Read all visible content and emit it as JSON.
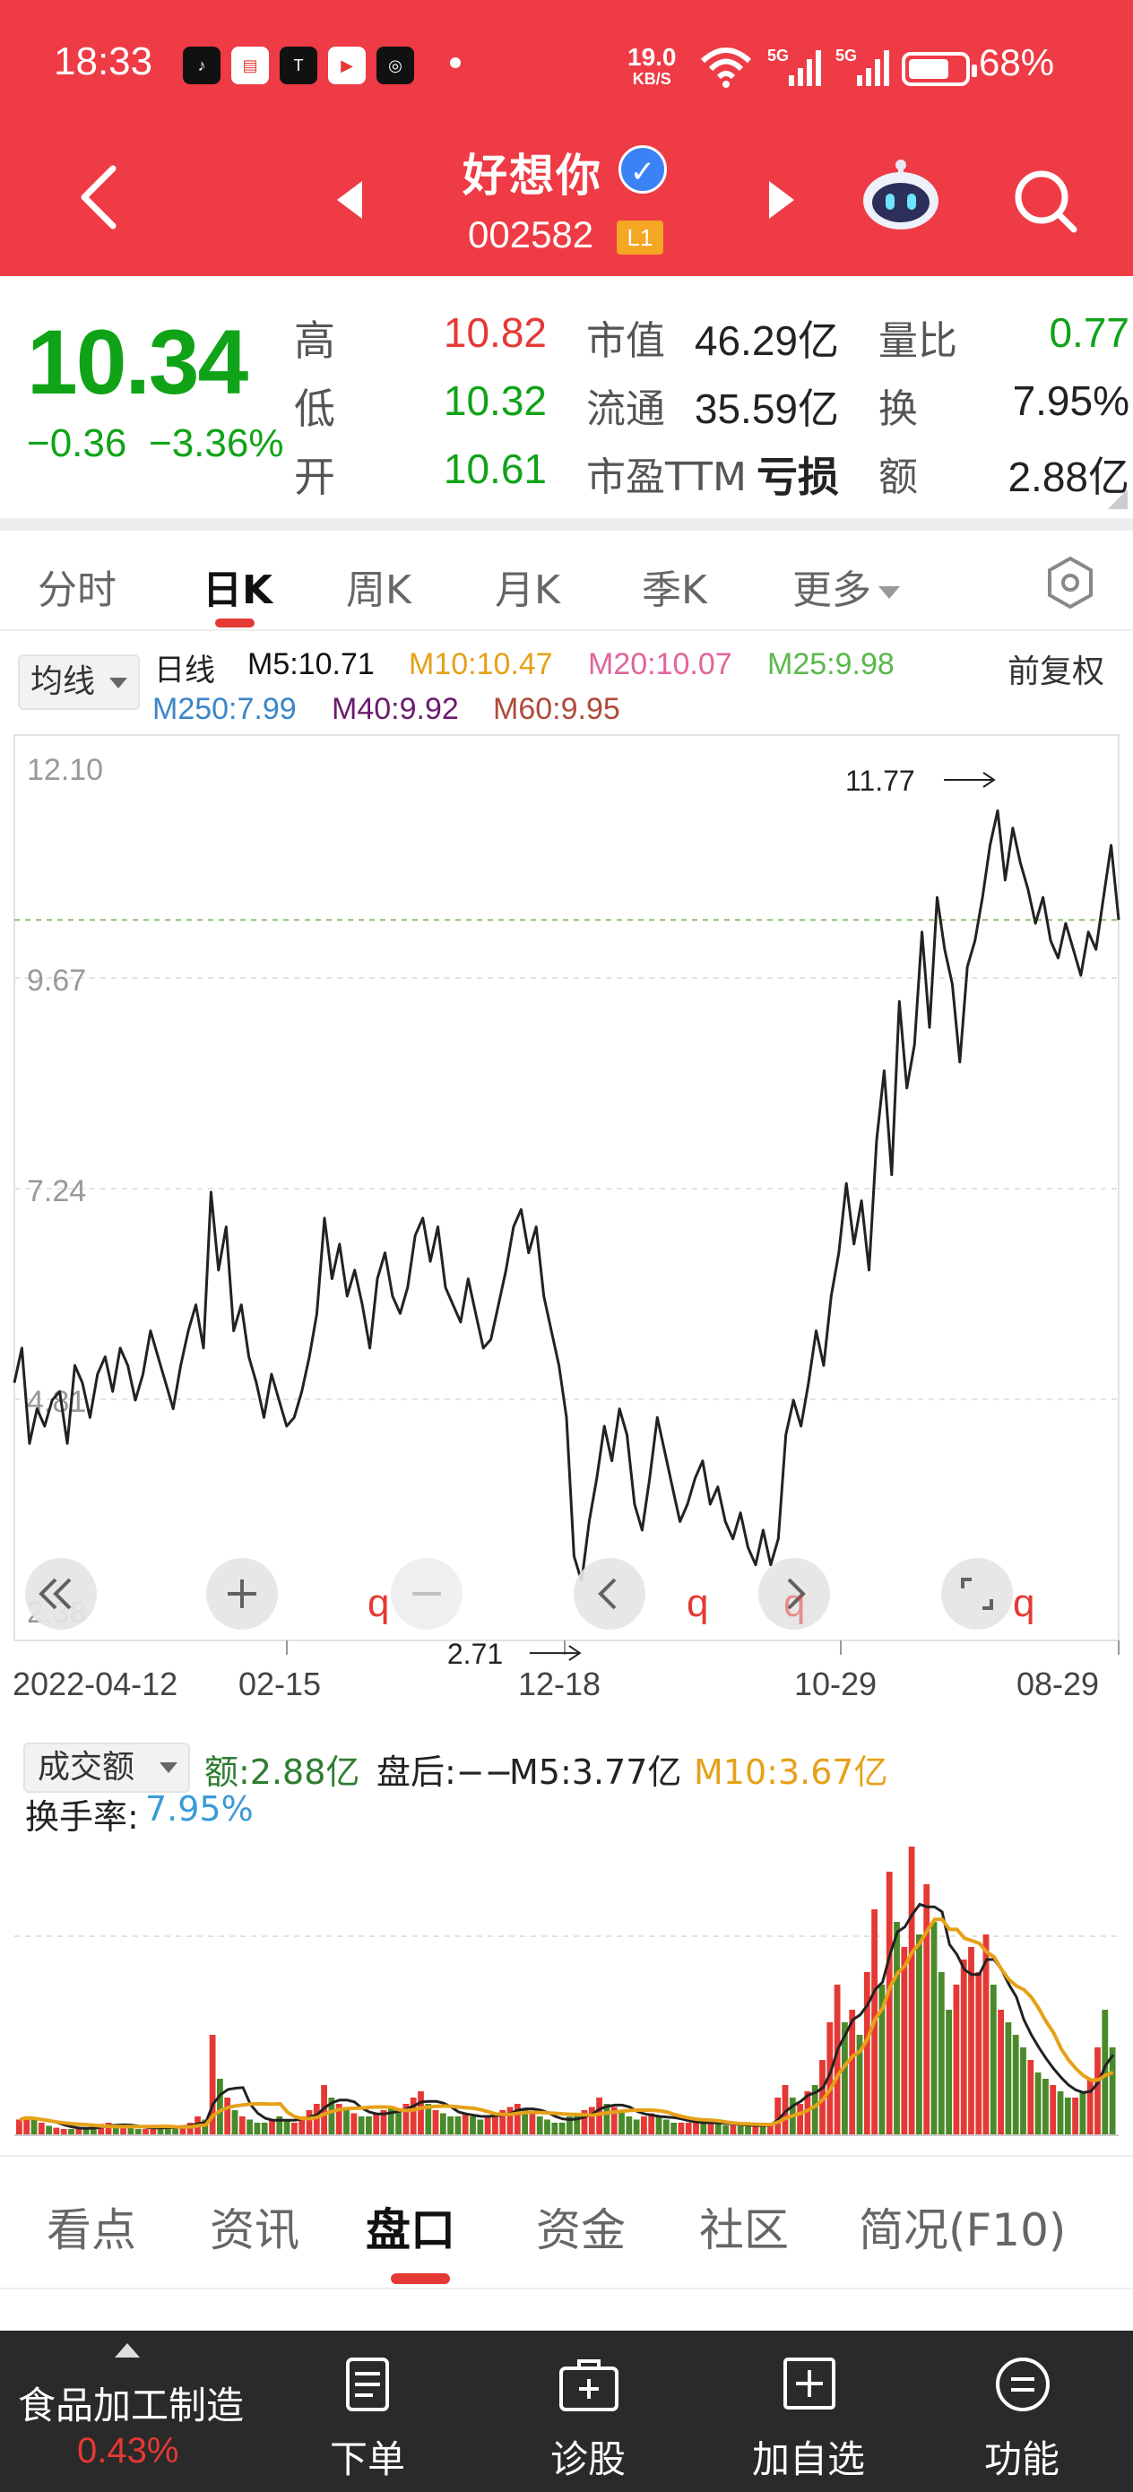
{
  "status_bar": {
    "time": "18:33",
    "net_speed_value": "19.0",
    "net_speed_unit": "KB/S",
    "signal_1": "5G",
    "signal_2": "5G",
    "battery_percent": "68%",
    "app_icons": [
      "tiktok-icon",
      "toutiao-icon",
      "tesla-icon",
      "youtube-icon",
      "app-icon"
    ]
  },
  "header": {
    "stock_name": "好想你",
    "stock_code": "002582",
    "level_badge": "L1",
    "verified_mark": "✓",
    "accent_color": "#ee3b45"
  },
  "quote": {
    "price": "10.34",
    "change": "−0.36",
    "change_pct": "−3.36%",
    "stats": [
      {
        "label": "高",
        "value": "10.82",
        "color": "red"
      },
      {
        "label": "低",
        "value": "10.32",
        "color": "green"
      },
      {
        "label": "开",
        "value": "10.61",
        "color": "green"
      }
    ],
    "market": [
      {
        "label": "市值",
        "value": "46.29亿"
      },
      {
        "label": "流通",
        "value": "35.59亿"
      },
      {
        "label": "市盈TTM",
        "value": "亏损"
      }
    ],
    "ratios": [
      {
        "label": "量比",
        "value": "0.77",
        "color": "green"
      },
      {
        "label": "换",
        "value": "7.95%",
        "color": "black"
      },
      {
        "label": "额",
        "value": "2.88亿",
        "color": "black"
      }
    ]
  },
  "period_tabs": {
    "items": [
      "分时",
      "日K",
      "周K",
      "月K",
      "季K",
      "更多"
    ],
    "active": "日K"
  },
  "ma_legend": {
    "selector": "均线",
    "line_type": "日线",
    "entries": [
      {
        "text": "M5:10.71",
        "color": "#111111"
      },
      {
        "text": "M10:10.47",
        "color": "#e6a118"
      },
      {
        "text": "M20:10.07",
        "color": "#e0659b"
      },
      {
        "text": "M25:9.98",
        "color": "#59b94a"
      },
      {
        "text": "M250:7.99",
        "color": "#3a86c8"
      },
      {
        "text": "M40:9.92",
        "color": "#6a1b6e"
      },
      {
        "text": "M60:9.95",
        "color": "#b04a3a"
      }
    ],
    "adjust": "前复权"
  },
  "chart_data": [
    {
      "type": "line",
      "y_ticks": [
        "12.10",
        "9.67",
        "7.24",
        "4.81",
        "2.38"
      ],
      "ylim": [
        2.38,
        12.1
      ],
      "reference_value": 10.34,
      "x_tick_labels": [
        "2022-04-12",
        "02-15",
        "12-18",
        "10-29",
        "08-29"
      ],
      "annotations": [
        {
          "text": "11.77",
          "kind": "max"
        },
        {
          "text": "2.71",
          "kind": "min"
        }
      ],
      "values": [
        5.0,
        5.4,
        4.3,
        4.7,
        4.5,
        4.8,
        4.9,
        4.3,
        5.2,
        5.0,
        4.6,
        5.1,
        5.3,
        4.9,
        5.4,
        5.2,
        4.8,
        5.1,
        5.6,
        5.3,
        5.0,
        4.7,
        5.2,
        5.6,
        5.9,
        5.4,
        7.2,
        6.3,
        6.8,
        5.6,
        5.9,
        5.3,
        5.0,
        4.6,
        5.1,
        4.8,
        4.5,
        4.6,
        4.9,
        5.3,
        5.8,
        6.9,
        6.2,
        6.6,
        6.0,
        6.3,
        5.9,
        5.4,
        6.2,
        6.5,
        6.0,
        5.8,
        6.1,
        6.7,
        6.9,
        6.4,
        6.8,
        6.1,
        5.9,
        5.7,
        6.2,
        5.8,
        5.4,
        5.5,
        5.9,
        6.3,
        6.8,
        7.0,
        6.5,
        6.8,
        6.0,
        5.6,
        5.2,
        4.6,
        3.0,
        2.71,
        3.4,
        3.9,
        4.5,
        4.1,
        4.7,
        4.4,
        3.6,
        3.3,
        3.9,
        4.6,
        4.2,
        3.8,
        3.4,
        3.6,
        3.9,
        4.1,
        3.6,
        3.8,
        3.4,
        3.2,
        3.5,
        3.1,
        2.9,
        3.3,
        2.9,
        3.2,
        4.4,
        4.8,
        4.5,
        5.0,
        5.6,
        5.2,
        6.0,
        6.5,
        7.3,
        6.6,
        7.1,
        6.3,
        7.8,
        8.6,
        7.4,
        9.4,
        8.4,
        8.9,
        10.2,
        9.1,
        10.6,
        10.0,
        9.6,
        8.7,
        9.8,
        10.1,
        10.6,
        11.2,
        11.6,
        10.8,
        11.4,
        11.0,
        10.7,
        10.3,
        10.6,
        10.1,
        9.9,
        10.3,
        10.0,
        9.7,
        10.2,
        10.0,
        10.6,
        11.2,
        10.34
      ]
    },
    {
      "type": "bar",
      "title": "成交额",
      "values": [
        0.25,
        0.3,
        0.25,
        0.2,
        0.15,
        0.12,
        0.1,
        0.1,
        0.1,
        0.12,
        0.15,
        0.18,
        0.2,
        0.16,
        0.14,
        0.12,
        0.1,
        0.1,
        0.12,
        0.15,
        0.14,
        0.12,
        0.16,
        0.2,
        0.3,
        0.25,
        1.6,
        0.9,
        0.6,
        0.4,
        0.3,
        0.25,
        0.2,
        0.2,
        0.25,
        0.3,
        0.25,
        0.2,
        0.3,
        0.4,
        0.5,
        0.8,
        0.6,
        0.5,
        0.4,
        0.35,
        0.3,
        0.3,
        0.35,
        0.4,
        0.45,
        0.4,
        0.5,
        0.6,
        0.7,
        0.5,
        0.4,
        0.35,
        0.3,
        0.3,
        0.35,
        0.3,
        0.25,
        0.3,
        0.35,
        0.4,
        0.45,
        0.5,
        0.4,
        0.35,
        0.3,
        0.25,
        0.2,
        0.2,
        0.3,
        0.35,
        0.4,
        0.45,
        0.6,
        0.5,
        0.45,
        0.4,
        0.3,
        0.25,
        0.3,
        0.35,
        0.3,
        0.25,
        0.2,
        0.2,
        0.2,
        0.2,
        0.2,
        0.2,
        0.18,
        0.16,
        0.16,
        0.15,
        0.15,
        0.16,
        0.16,
        0.2,
        0.6,
        0.8,
        0.6,
        0.5,
        0.7,
        0.8,
        1.2,
        1.8,
        2.4,
        1.8,
        2.0,
        1.6,
        2.6,
        3.6,
        2.4,
        4.2,
        3.4,
        3.0,
        4.6,
        3.2,
        4.0,
        3.4,
        2.6,
        2.0,
        2.4,
        2.8,
        3.0,
        2.6,
        3.2,
        2.4,
        2.0,
        1.8,
        1.6,
        1.4,
        1.2,
        1.0,
        0.9,
        0.8,
        0.7,
        0.6,
        0.6,
        0.7,
        0.9,
        1.4,
        2.0,
        1.4
      ],
      "legend": {
        "amount": "额:2.88亿",
        "after_hours": "盘后:−−",
        "m5": "M5:3.77亿",
        "m10": "M10:3.67亿",
        "turnover_label": "换手率:",
        "turnover_value": "7.95%"
      }
    }
  ],
  "bottom_tabs": {
    "items": [
      "看点",
      "资讯",
      "盘口",
      "资金",
      "社区",
      "简况(F10)"
    ],
    "active": "盘口"
  },
  "footer": {
    "industry_name": "食品加工制造",
    "industry_change": "0.43%",
    "buttons": [
      {
        "label": "下单",
        "icon": "order-icon"
      },
      {
        "label": "诊股",
        "icon": "diagnose-icon"
      },
      {
        "label": "加自选",
        "icon": "add-watchlist-icon"
      },
      {
        "label": "功能",
        "icon": "menu-icon"
      }
    ]
  },
  "colors": {
    "rise": "#e53935",
    "fall": "#10a318",
    "line": "#222222",
    "grid": "#d8d8d8",
    "ref_line": "#8fbf78"
  }
}
